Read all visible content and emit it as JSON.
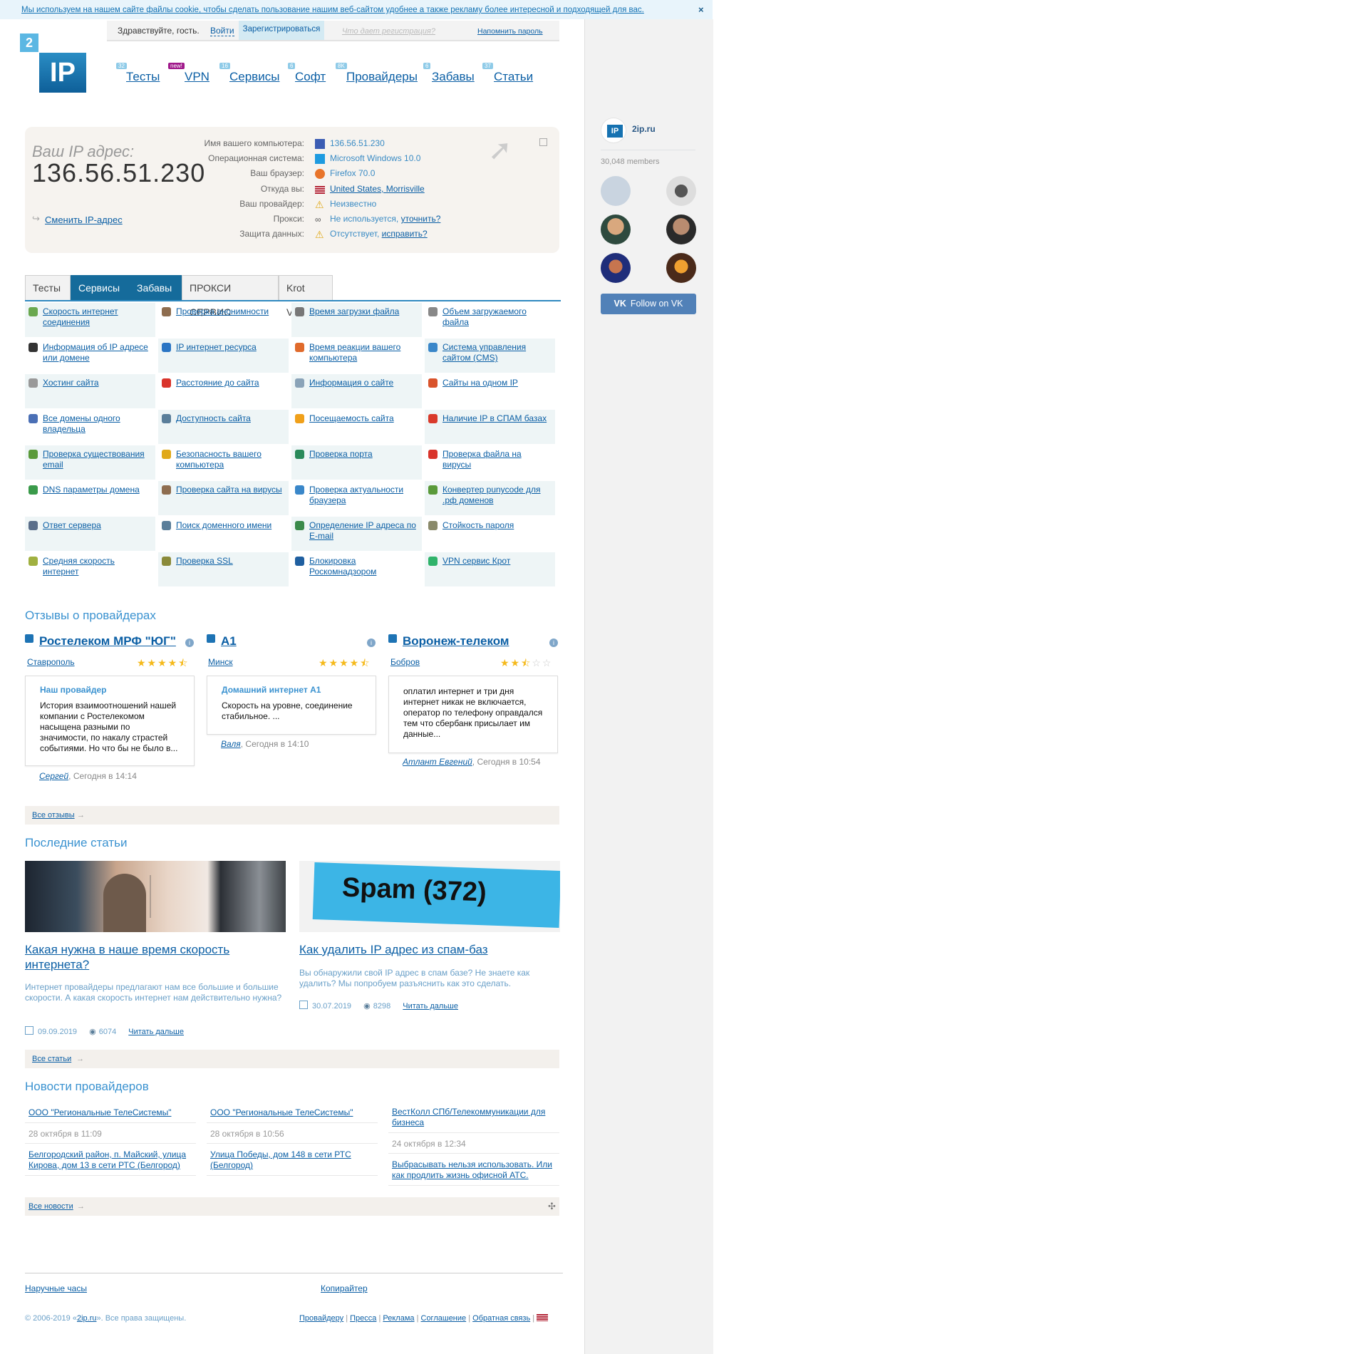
{
  "cookie": {
    "text": "Мы используем на нашем сайте файлы cookie, чтобы сделать пользование нашим веб-сайтом удобнее а также рекламу более интересной и подходящей для вас.",
    "close": "×"
  },
  "userbar": {
    "hello": "Здравствуйте, гость.",
    "login": "Войти",
    "register": "Зарегистрироваться",
    "why": "Что дает регистрация?",
    "remind": "Напомнить пароль"
  },
  "logo": {
    "two": "2",
    "ip": "IP"
  },
  "nav": [
    {
      "label": "Тесты",
      "badge": "32"
    },
    {
      "label": "VPN",
      "badge": "new!"
    },
    {
      "label": "Сервисы",
      "badge": "16"
    },
    {
      "label": "Софт",
      "badge": "6"
    },
    {
      "label": "Провайдеры",
      "badge": "8K"
    },
    {
      "label": "Забавы",
      "badge": "6"
    },
    {
      "label": "Статьи",
      "badge": "37"
    }
  ],
  "ipbox": {
    "label": "Ваш IP адрес:",
    "ip": "136.56.51.230",
    "change": "Сменить IP-адрес",
    "rows": [
      {
        "key": "Имя вашего компьютера:",
        "value": "136.56.51.230",
        "icon": "computer-icon",
        "color": "#3b5cb3"
      },
      {
        "key": "Операционная система:",
        "value": "Microsoft Windows 10.0",
        "icon": "windows-icon",
        "color": "#1e9be0"
      },
      {
        "key": "Ваш браузер:",
        "value": "Firefox 70.0",
        "icon": "firefox-icon",
        "color": "#e8742a"
      },
      {
        "key": "Откуда вы:",
        "value": "United States, Morrisville",
        "icon": "us-flag-icon",
        "color": "#b22234"
      },
      {
        "key": "Ваш провайдер:",
        "value": "Неизвестно",
        "icon": "warning-icon",
        "color": "#f2c21b"
      },
      {
        "key": "Прокси:",
        "value": "Не используется,",
        "extra": "уточнить?",
        "icon": "glasses-icon",
        "color": "#777777"
      },
      {
        "key": "Защита данных:",
        "value": "Отсутствует,",
        "extra": "исправить?",
        "icon": "warning-icon",
        "color": "#f2c21b"
      }
    ]
  },
  "tabs": [
    "Тесты",
    "Сервисы",
    "Забавы",
    "ПРОКСИ СЕРВИС",
    "Krot VPN"
  ],
  "services": [
    [
      {
        "label": "Скорость интернет соединения",
        "icon": "speed-icon",
        "color": "#6aa84f"
      },
      {
        "label": "Проверка анонимности",
        "icon": "anonymity-icon",
        "color": "#8e6d4f"
      },
      {
        "label": "Время загрузки файла",
        "icon": "clock-icon",
        "color": "#777777"
      },
      {
        "label": "Объем загружаемого файла",
        "icon": "file-size-icon",
        "color": "#888888"
      }
    ],
    [
      {
        "label": "Информация об IP адресе или домене",
        "icon": "ip-info-icon",
        "color": "#333333"
      },
      {
        "label": "IP интернет ресурса",
        "icon": "ip-resource-icon",
        "color": "#2a75c4"
      },
      {
        "label": "Время реакции вашего компьютера",
        "icon": "reaction-icon",
        "color": "#e06a2b"
      },
      {
        "label": "Система управления сайтом (CMS)",
        "icon": "cms-icon",
        "color": "#3a87c9"
      }
    ],
    [
      {
        "label": "Хостинг сайта",
        "icon": "hosting-icon",
        "color": "#999999"
      },
      {
        "label": "Расстояние до сайта",
        "icon": "location-pin-icon",
        "color": "#d9342b"
      },
      {
        "label": "Информация о сайте",
        "icon": "site-info-icon",
        "color": "#8aa3b8"
      },
      {
        "label": "Сайты на одном IP",
        "icon": "sites-same-ip-icon",
        "color": "#d9532b"
      }
    ],
    [
      {
        "label": "Все домены одного владельца",
        "icon": "domains-owner-icon",
        "color": "#4a6fb5"
      },
      {
        "label": "Доступность сайта",
        "icon": "availability-icon",
        "color": "#5a7e9a"
      },
      {
        "label": "Посещаемость сайта",
        "icon": "star-icon",
        "color": "#f0a01a"
      },
      {
        "label": "Наличие IP в СПАМ базах",
        "icon": "spam-icon",
        "color": "#d93a2b"
      }
    ],
    [
      {
        "label": "Проверка существования email",
        "icon": "email-check-icon",
        "color": "#5a9a3a"
      },
      {
        "label": "Безопасность вашего компьютера",
        "icon": "lock-icon",
        "color": "#e0a91a"
      },
      {
        "label": "Проверка порта",
        "icon": "port-icon",
        "color": "#2a8a5a"
      },
      {
        "label": "Проверка файла на вирусы",
        "icon": "file-virus-icon",
        "color": "#d9342b"
      }
    ],
    [
      {
        "label": "DNS параметры домена",
        "icon": "dns-icon",
        "color": "#3a9a4a"
      },
      {
        "label": "Проверка сайта на вирусы",
        "icon": "site-virus-icon",
        "color": "#8e6d4f"
      },
      {
        "label": "Проверка актуальности браузера",
        "icon": "browser-icon",
        "color": "#3a87c9"
      },
      {
        "label": "Конвертер punycode для .рф доменов",
        "icon": "punycode-icon",
        "color": "#5a9a3a"
      }
    ],
    [
      {
        "label": "Ответ сервера",
        "icon": "server-icon",
        "color": "#5a6e8a"
      },
      {
        "label": "Поиск доменного имени",
        "icon": "domain-search-icon",
        "color": "#5a7e9a"
      },
      {
        "label": "Определение IP адреса по E-mail",
        "icon": "email-ip-icon",
        "color": "#3a8a4a"
      },
      {
        "label": "Стойкость пароля",
        "icon": "password-icon",
        "color": "#8a8a6a"
      }
    ],
    [
      {
        "label": "Средняя скорость интернет",
        "icon": "avg-speed-icon",
        "color": "#a0b040"
      },
      {
        "label": "Проверка SSL",
        "icon": "ssl-icon",
        "color": "#8a8a3a"
      },
      {
        "label": "Блокировка Роскомнадзором",
        "icon": "block-icon",
        "color": "#1f5fa0"
      },
      {
        "label": "VPN сервис Крот",
        "icon": "krot-icon",
        "color": "#2fb36a"
      }
    ]
  ],
  "reviews": {
    "title": "Отзывы о провайдерах",
    "items": [
      {
        "provider": "Ростелеком МРФ \"ЮГ\"",
        "city": "Ставрополь",
        "rating": 4.5,
        "heading": "Наш провайдер",
        "text": "История взаимоотношений нашей компании с Ростелекомом насыщена разными по значимости, по накалу страстей событиями. Но что бы не было в...",
        "author": "Сергей",
        "time": ", Сегодня в 14:14"
      },
      {
        "provider": "A1",
        "city": "Минск",
        "rating": 4.5,
        "heading": "Домашний интернет A1",
        "text": "Скорость на уровне, соединение стабильное. ...",
        "author": "Валя",
        "time": ", Сегодня в 14:10"
      },
      {
        "provider": "Воронеж-телеком",
        "city": "Бобров",
        "rating": 2.5,
        "heading": "",
        "text": "оплатил интернет и три дня интернет никак не включается, оператор по телефону оправдался тем что сбербанк присылает им данные...",
        "author": "Атлант Евгений",
        "time": ", Сегодня в 10:54"
      }
    ],
    "all": "Все отзывы"
  },
  "articles": {
    "title": "Последние статьи",
    "items": [
      {
        "title": "Какая нужна в наше время скорость интернета?",
        "desc": "Интернет провайдеры предлагают нам все большие и большие скорости. А какая скорость интернет нам действительно нужна?",
        "date": "09.09.2019",
        "views": "6074",
        "more": "Читать дальше"
      },
      {
        "title": "Как удалить IP адрес из спам-баз",
        "desc": "Вы обнаружили свой IP адрес в спам базе? Не знаете как удалить? Мы попробуем разъяснить как это сделать.",
        "date": "30.07.2019",
        "views": "8298",
        "more": "Читать дальше",
        "image_text": "Spam (372)"
      }
    ],
    "all": "Все статьи"
  },
  "news": {
    "title": "Новости провайдеров",
    "cols": [
      {
        "provider": "ООО \"Региональные ТелеСистемы\"",
        "date": "28 октября в 11:09",
        "headline": "Белгородский район, п. Майский, улица Кирова, дом 13 в сети РТС (Белгород)"
      },
      {
        "provider": "ООО \"Региональные ТелеСистемы\"",
        "date": "28 октября в 10:56",
        "headline": "Улица Победы, дом 148 в сети РТС (Белгород)"
      },
      {
        "provider": "ВестКолл СПб/Телекоммуникации для бизнеса",
        "date": "24 октября в 12:34",
        "headline": "Выбрасывать нельзя использовать. Или как продлить жизнь офисной АТС."
      }
    ],
    "all": "Все новости"
  },
  "footer": {
    "left": "Наручные часы",
    "right": "Копирайтер",
    "copy_pre": "© 2006-2019 «",
    "copy_site": "2ip.ru",
    "copy_post": "». Все права защищены.",
    "links": [
      "Провайдеру",
      "Пресса",
      "Реклама",
      "Соглашение",
      "Обратная связь"
    ]
  },
  "vk": {
    "name": "2ip.ru",
    "logo": "IP",
    "members": "30,048 members",
    "follow": "Follow on VK"
  },
  "colors": {
    "link": "#0b5fa5",
    "accent": "#3a92d0",
    "tab_active": "#156b9b",
    "vk": "#5181b8"
  }
}
